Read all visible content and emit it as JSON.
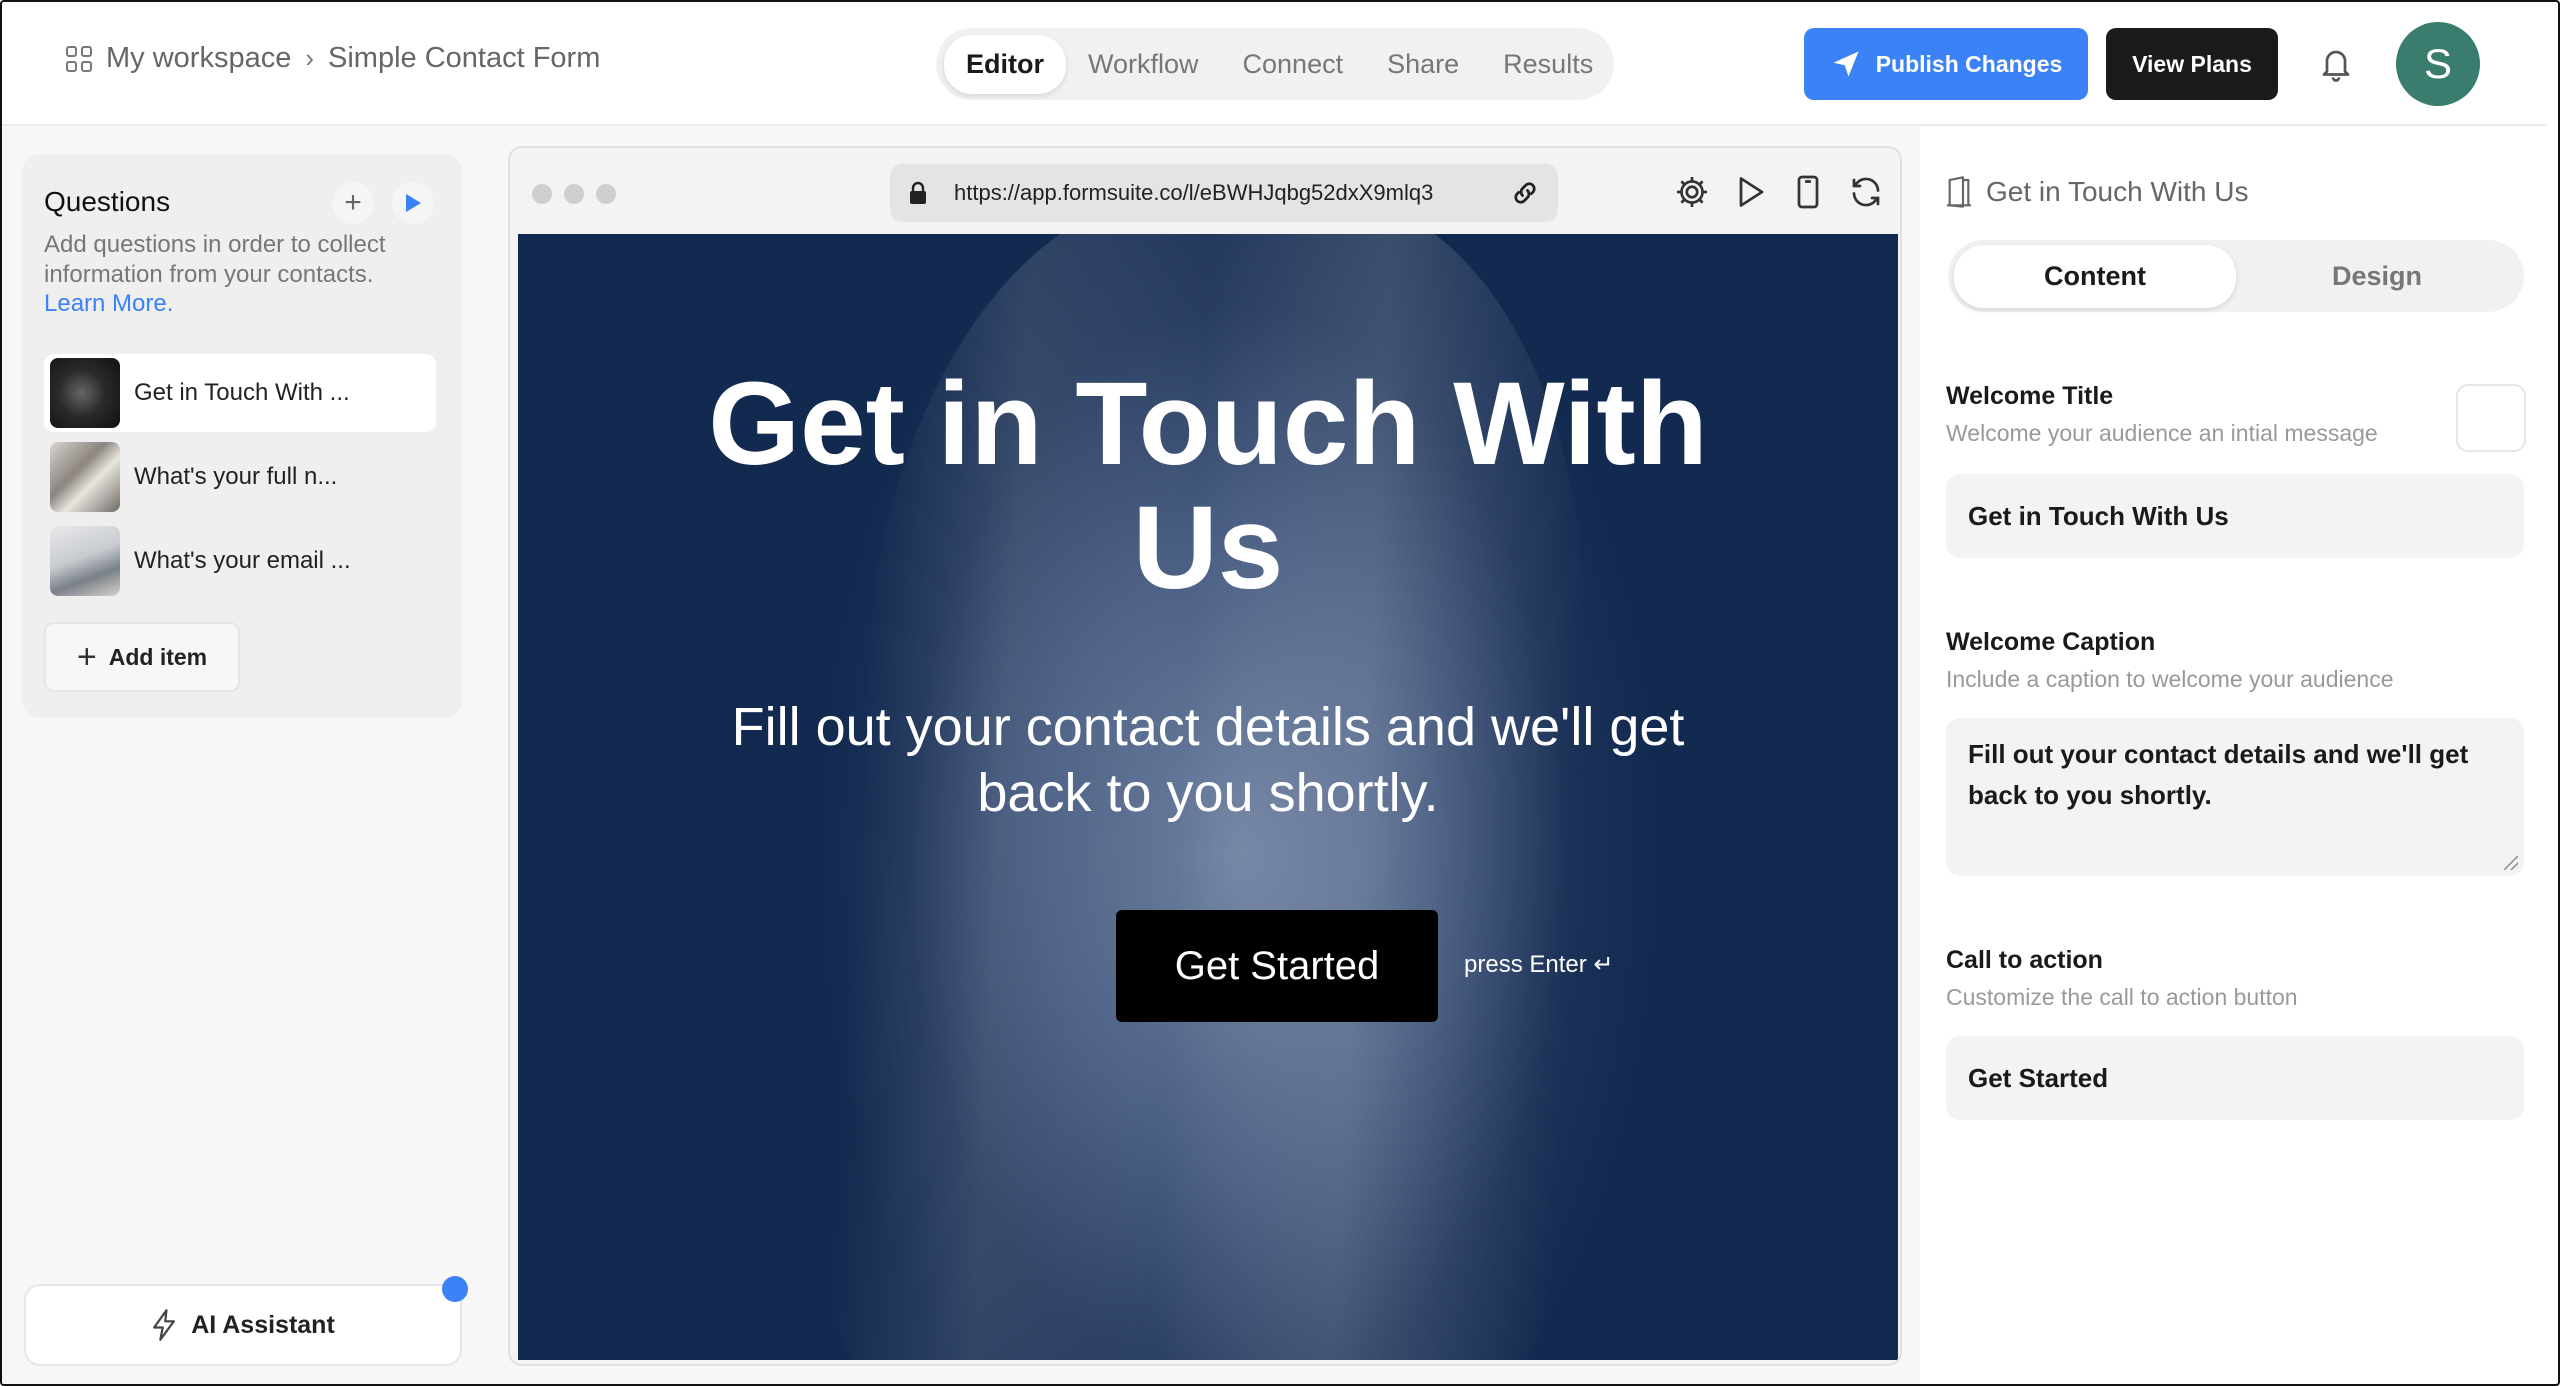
{
  "header": {
    "workspace": "My workspace",
    "form_name": "Simple Contact Form",
    "tabs": [
      {
        "label": "Editor",
        "active": true
      },
      {
        "label": "Workflow",
        "active": false
      },
      {
        "label": "Connect",
        "active": false
      },
      {
        "label": "Share",
        "active": false
      },
      {
        "label": "Results",
        "active": false
      }
    ],
    "publish_label": "Publish Changes",
    "plans_label": "View Plans",
    "avatar_initial": "S"
  },
  "questions": {
    "title": "Questions",
    "description": "Add questions in order to collect information from your contacts.",
    "learn_more": "Learn More.",
    "items": [
      {
        "label": "Get in Touch With ...",
        "active": true
      },
      {
        "label": "What's your full n...",
        "active": false
      },
      {
        "label": "What's your email ...",
        "active": false
      }
    ],
    "add_item_label": "Add item"
  },
  "ai_assistant_label": "AI Assistant",
  "preview": {
    "url": "https://app.formsuite.co/l/eBWHJqbg52dxX9mlq3",
    "title": "Get in Touch With Us",
    "caption": "Fill out your contact details and we'll get back to you shortly.",
    "cta": "Get Started",
    "hint": "press Enter ↵"
  },
  "settings": {
    "header": "Get in Touch With Us",
    "tabs": [
      {
        "label": "Content",
        "active": true
      },
      {
        "label": "Design",
        "active": false
      }
    ],
    "welcome_title": {
      "label": "Welcome Title",
      "hint": "Welcome your audience an intial message",
      "value": "Get in Touch With Us"
    },
    "welcome_caption": {
      "label": "Welcome Caption",
      "hint": "Include a caption to welcome your audience",
      "value": "Fill out your contact details and we'll get back to you shortly."
    },
    "call_to_action": {
      "label": "Call to action",
      "hint": "Customize the call to action button",
      "value": "Get Started"
    }
  },
  "colors": {
    "accent": "#3b82f6",
    "dark": "#1b1b1b",
    "avatar": "#3a7d6e",
    "preview_bg": "#1c3258"
  }
}
